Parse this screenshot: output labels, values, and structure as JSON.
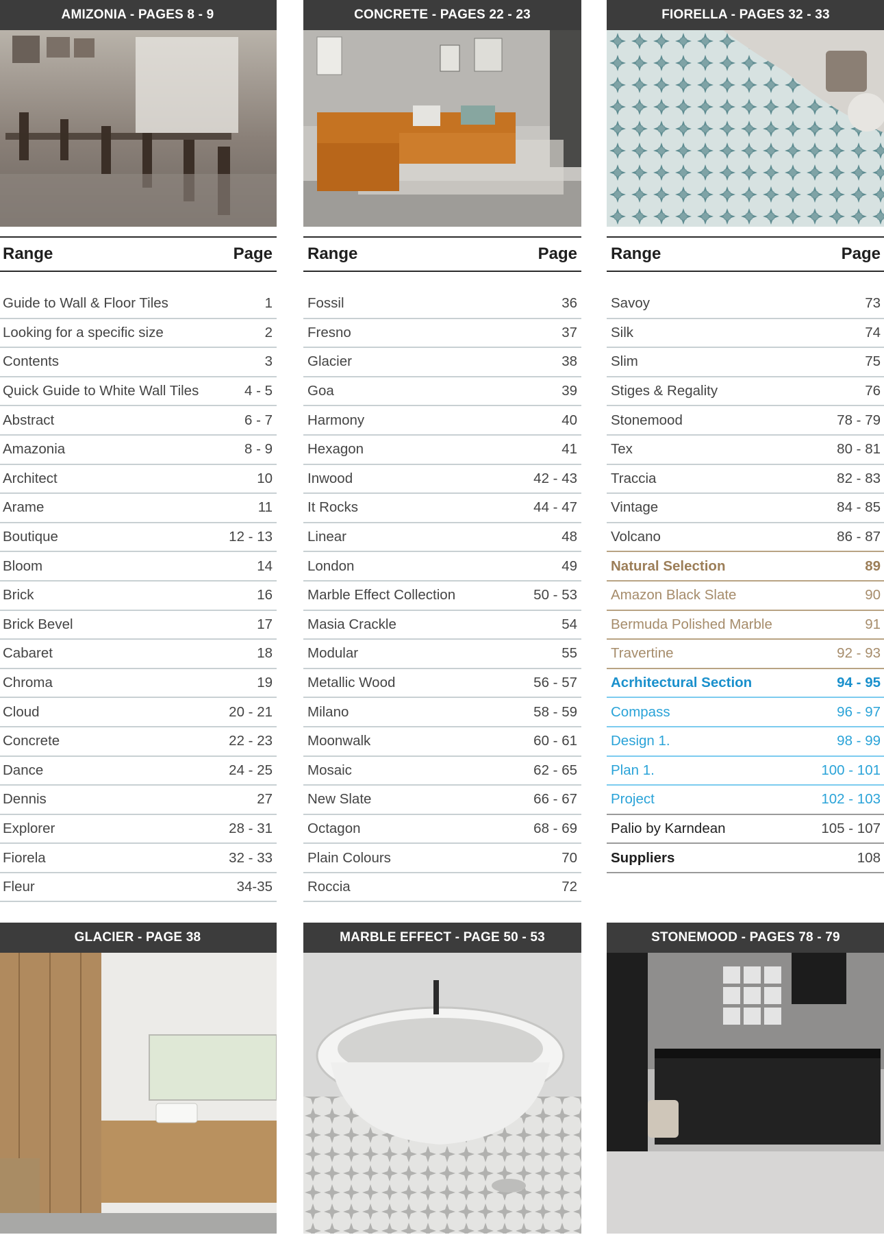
{
  "panels_top": [
    {
      "title": "AMIZONIA - PAGES 8 - 9",
      "image": "cafe-interior-photo"
    },
    {
      "title": "CONCRETE - PAGES 22 - 23",
      "image": "living-room-sofa-photo"
    },
    {
      "title": "FIORELLA - PAGES 32 - 33",
      "image": "patterned-floor-tile-photo"
    }
  ],
  "panels_bottom": [
    {
      "title": "GLACIER - PAGE 38",
      "image": "bathroom-vanity-photo"
    },
    {
      "title": "MARBLE EFFECT - PAGE 50 - 53",
      "image": "freestanding-bath-photo"
    },
    {
      "title": "STONEMOOD - PAGES 78 - 79",
      "image": "industrial-kitchen-photo"
    }
  ],
  "table_header": {
    "range": "Range",
    "page": "Page"
  },
  "columns": [
    {
      "rows": [
        {
          "name": "Guide to Wall & Floor Tiles",
          "page": "1"
        },
        {
          "name": "Looking for a specific size",
          "page": "2"
        },
        {
          "name": "Contents",
          "page": "3"
        },
        {
          "name": "Quick Guide to White Wall Tiles",
          "page": "4 - 5"
        },
        {
          "name": "Abstract",
          "page": "6 - 7"
        },
        {
          "name": "Amazonia",
          "page": "8 - 9"
        },
        {
          "name": "Architect",
          "page": "10"
        },
        {
          "name": "Arame",
          "page": "11"
        },
        {
          "name": "Boutique",
          "page": "12 - 13"
        },
        {
          "name": "Bloom",
          "page": "14"
        },
        {
          "name": "Brick",
          "page": "16"
        },
        {
          "name": "Brick Bevel",
          "page": "17"
        },
        {
          "name": "Cabaret",
          "page": "18"
        },
        {
          "name": "Chroma",
          "page": "19"
        },
        {
          "name": "Cloud",
          "page": "20 - 21"
        },
        {
          "name": "Concrete",
          "page": "22 - 23"
        },
        {
          "name": "Dance",
          "page": "24 - 25"
        },
        {
          "name": "Dennis",
          "page": "27"
        },
        {
          "name": "Explorer",
          "page": "28 - 31"
        },
        {
          "name": "Fiorela",
          "page": "32 - 33"
        },
        {
          "name": "Fleur",
          "page": "34-35"
        }
      ]
    },
    {
      "rows": [
        {
          "name": "Fossil",
          "page": "36"
        },
        {
          "name": "Fresno",
          "page": "37"
        },
        {
          "name": "Glacier",
          "page": "38"
        },
        {
          "name": "Goa",
          "page": "39"
        },
        {
          "name": "Harmony",
          "page": "40"
        },
        {
          "name": "Hexagon",
          "page": "41"
        },
        {
          "name": "Inwood",
          "page": "42 - 43"
        },
        {
          "name": "It Rocks",
          "page": "44 - 47"
        },
        {
          "name": "Linear",
          "page": "48"
        },
        {
          "name": "London",
          "page": "49"
        },
        {
          "name": "Marble Effect Collection",
          "page": "50 - 53"
        },
        {
          "name": "Masia Crackle",
          "page": "54"
        },
        {
          "name": "Modular",
          "page": "55"
        },
        {
          "name": "Metallic Wood",
          "page": "56 - 57"
        },
        {
          "name": "Milano",
          "page": "58 - 59"
        },
        {
          "name": "Moonwalk",
          "page": "60 - 61"
        },
        {
          "name": "Mosaic",
          "page": "62 - 65"
        },
        {
          "name": "New Slate",
          "page": "66 - 67"
        },
        {
          "name": "Octagon",
          "page": "68 - 69"
        },
        {
          "name": "Plain Colours",
          "page": "70"
        },
        {
          "name": "Roccia",
          "page": "72"
        }
      ]
    },
    {
      "rows": [
        {
          "name": "Savoy",
          "page": "73"
        },
        {
          "name": "Silk",
          "page": "74"
        },
        {
          "name": "Slim",
          "page": "75"
        },
        {
          "name": "Stiges & Regality",
          "page": "76"
        },
        {
          "name": "Stonemood",
          "page": "78 - 79"
        },
        {
          "name": "Tex",
          "page": "80 - 81"
        },
        {
          "name": "Traccia",
          "page": "82 - 83"
        },
        {
          "name": "Vintage",
          "page": "84 - 85"
        },
        {
          "name": "Volcano",
          "page": "86 - 87"
        },
        {
          "name": "Natural Selection",
          "page": "89"
        },
        {
          "name": "Amazon Black Slate",
          "page": "90"
        },
        {
          "name": "Bermuda Polished Marble",
          "page": "91"
        },
        {
          "name": "Travertine",
          "page": "92 - 93"
        },
        {
          "name": "Acrhitectural Section",
          "page": "94 - 95"
        },
        {
          "name": "Compass",
          "page": "96 - 97"
        },
        {
          "name": "Design 1.",
          "page": "98 - 99"
        },
        {
          "name": "Plan 1.",
          "page": "100 - 101"
        },
        {
          "name": "Project",
          "page": "102 - 103"
        },
        {
          "name": "Palio by Karndean",
          "page": "105 - 107"
        },
        {
          "name": "Suppliers",
          "page": "108"
        }
      ]
    }
  ],
  "colors": {
    "header_bg": "#3c3c3c",
    "natural_accent": "#a68c6b",
    "architectural_accent": "#2aa3d8"
  }
}
